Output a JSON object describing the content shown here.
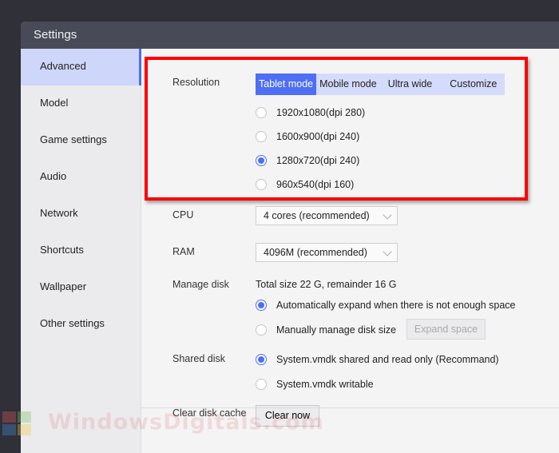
{
  "window": {
    "title": "Settings"
  },
  "sidebar": {
    "items": [
      {
        "label": "Advanced",
        "active": true
      },
      {
        "label": "Model"
      },
      {
        "label": "Game settings"
      },
      {
        "label": "Audio"
      },
      {
        "label": "Network"
      },
      {
        "label": "Shortcuts"
      },
      {
        "label": "Wallpaper"
      },
      {
        "label": "Other settings"
      }
    ]
  },
  "resolution": {
    "label": "Resolution",
    "tabs": [
      "Tablet mode",
      "Mobile mode",
      "Ultra wide",
      "Customize"
    ],
    "active_tab": "Tablet mode",
    "options": [
      "1920x1080(dpi 280)",
      "1600x900(dpi 240)",
      "1280x720(dpi 240)",
      "960x540(dpi 160)"
    ],
    "selected": "1280x720(dpi 240)"
  },
  "cpu": {
    "label": "CPU",
    "value": "4 cores (recommended)"
  },
  "ram": {
    "label": "RAM",
    "value": "4096M (recommended)"
  },
  "manage_disk": {
    "label": "Manage disk",
    "info": "Total size 22 G, remainder 16 G",
    "options": [
      "Automatically expand when there is not enough space",
      "Manually manage disk size"
    ],
    "selected": "Automatically expand when there is not enough space",
    "expand_button": "Expand space"
  },
  "shared_disk": {
    "label": "Shared disk",
    "options": [
      "System.vmdk shared and read only (Recommand)",
      "System.vmdk writable"
    ],
    "selected": "System.vmdk shared and read only (Recommand)"
  },
  "clear_cache": {
    "label": "Clear disk cache",
    "button": "Clear now"
  },
  "watermark": {
    "text": "WindowsDigitals.com"
  },
  "colors": {
    "accent": "#4d6ef5",
    "annotation": "#ff0000",
    "titlebar": "#484b57"
  }
}
